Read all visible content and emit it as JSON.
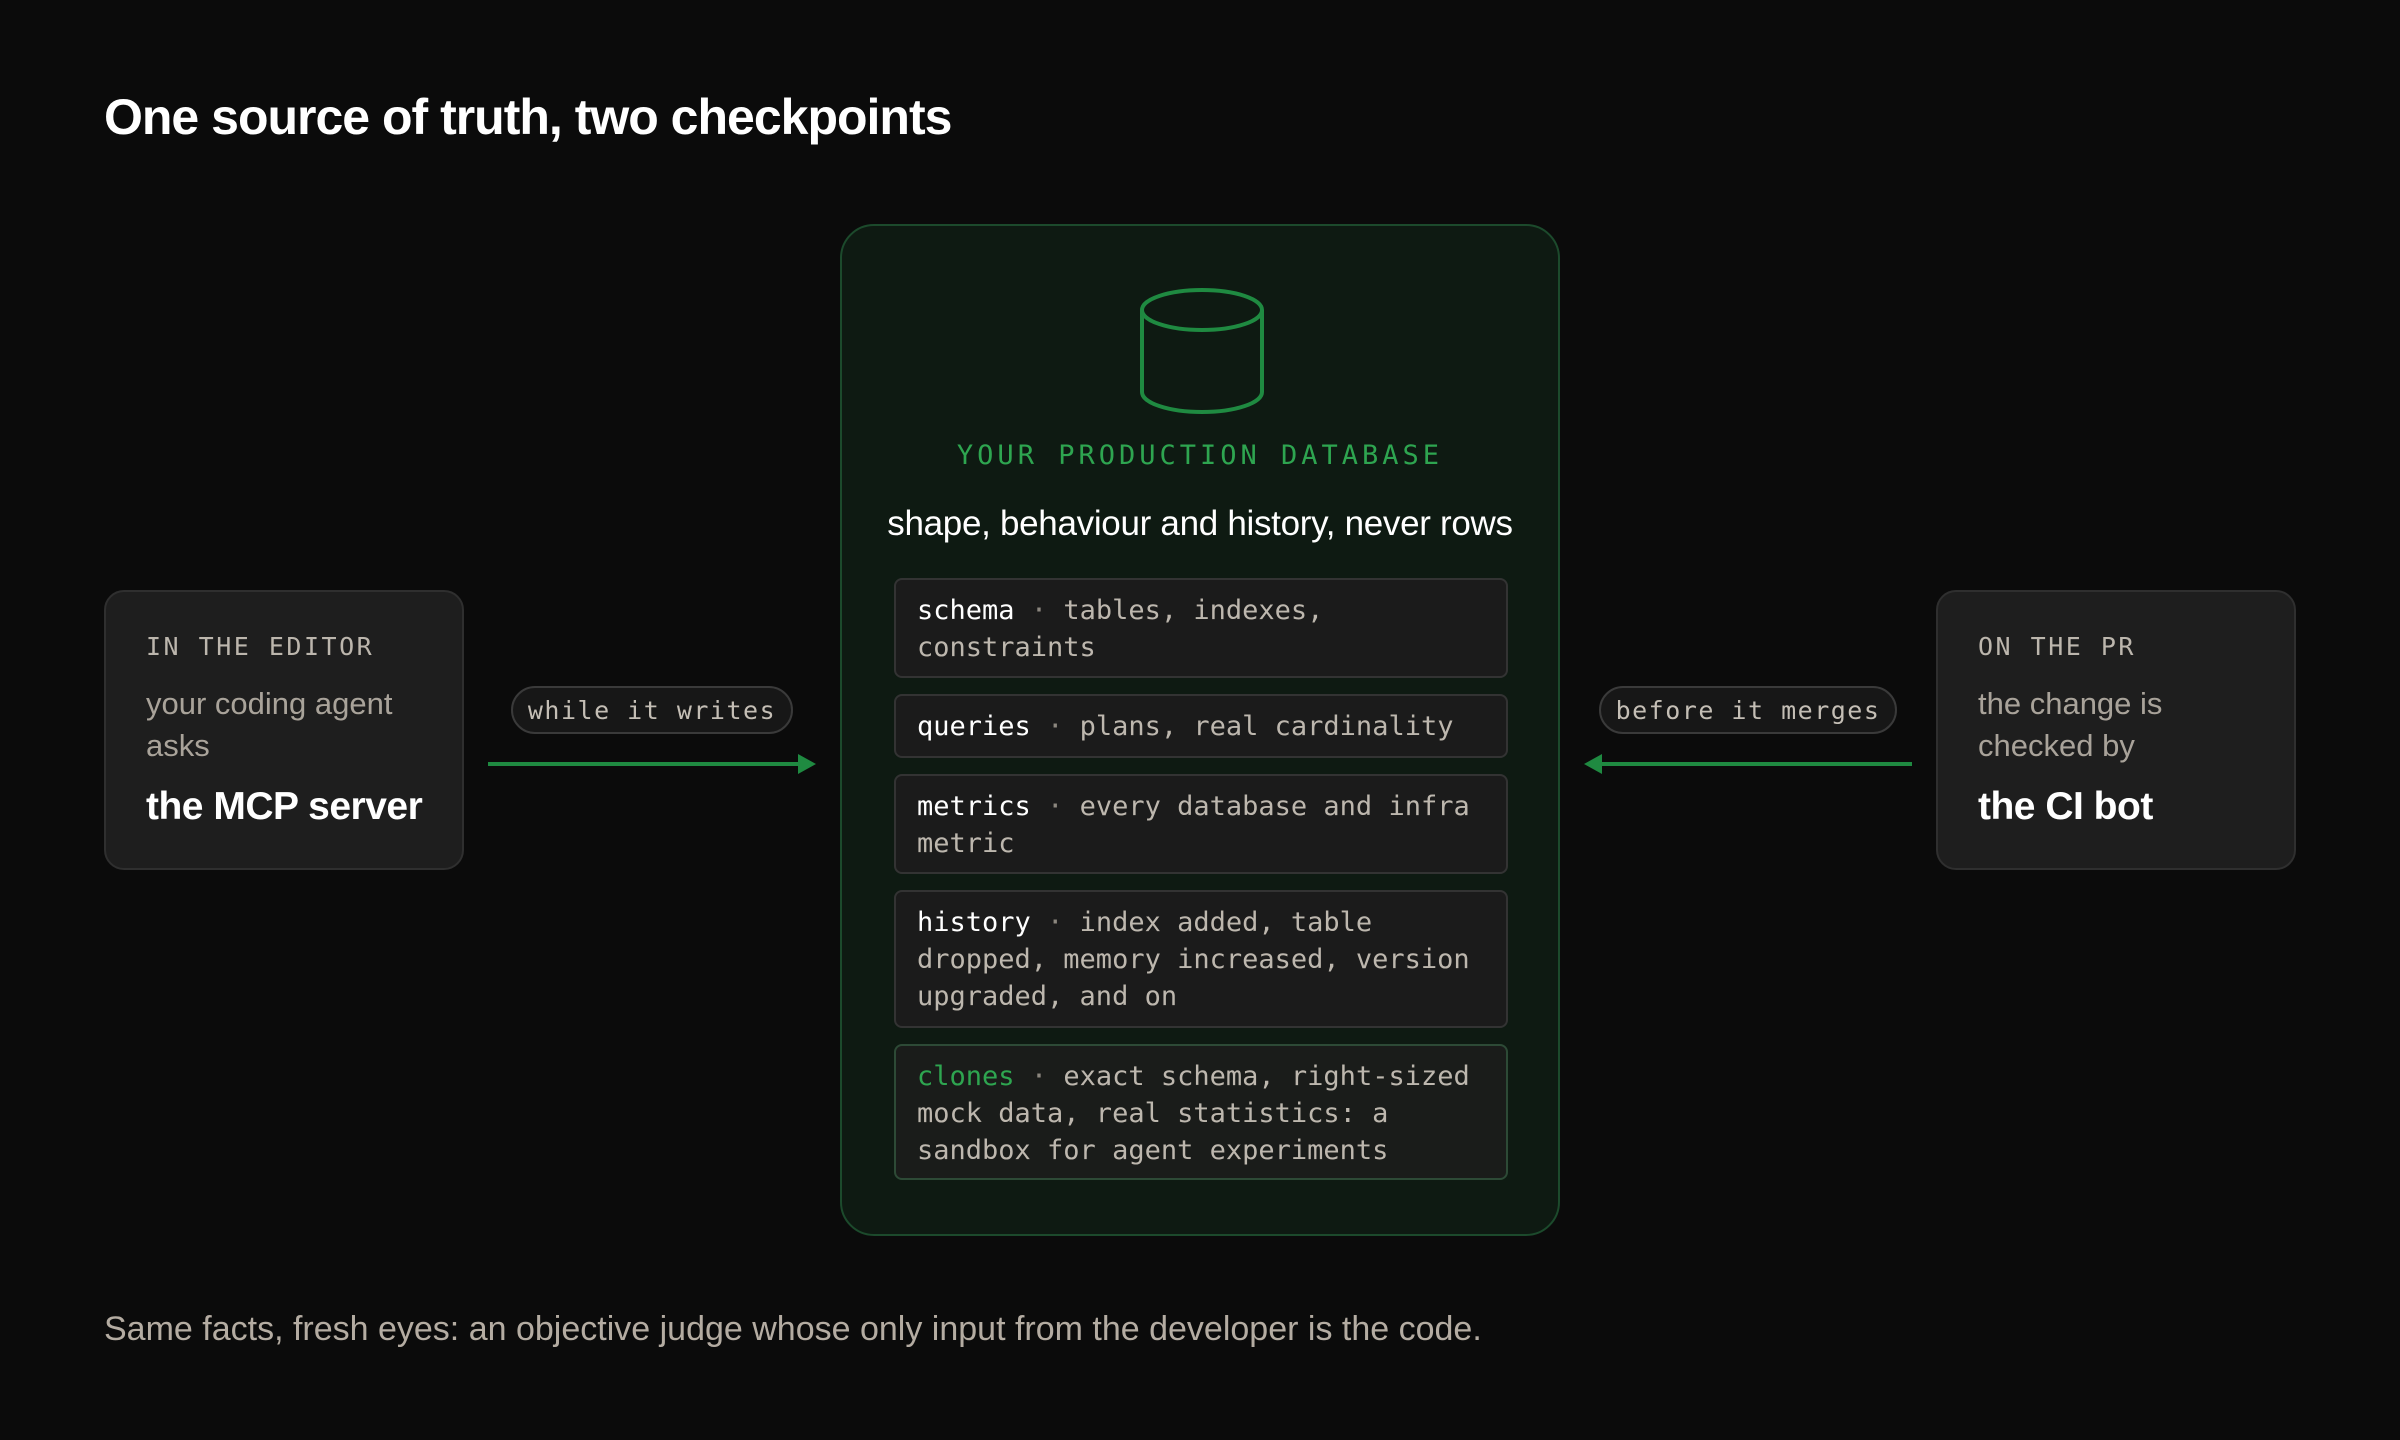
{
  "title": "One source of truth, two checkpoints",
  "left_card": {
    "eyebrow": "IN THE EDITOR",
    "subtitle": "your coding agent asks",
    "main": "the MCP server"
  },
  "left_connector": {
    "label": "while it writes"
  },
  "right_card": {
    "eyebrow": "ON THE PR",
    "subtitle": "the change is checked by",
    "main": "the CI bot"
  },
  "right_connector": {
    "label": "before it merges"
  },
  "database": {
    "icon": "database-cylinder-icon",
    "eyebrow": "YOUR PRODUCTION DATABASE",
    "tagline": "shape, behaviour and history, never rows",
    "features": [
      {
        "name": "schema",
        "separator": "·",
        "desc": "tables, indexes, constraints"
      },
      {
        "name": "queries",
        "separator": "·",
        "desc": "plans, real cardinality"
      },
      {
        "name": "metrics",
        "separator": "·",
        "desc": "every database and infra metric"
      },
      {
        "name": "history",
        "separator": "·",
        "desc": "index added, table dropped, memory increased, version upgraded, and on"
      },
      {
        "name": "clones",
        "separator": "·",
        "desc": "exact schema, right-sized mock data, real statistics: a sandbox for agent experiments"
      }
    ]
  },
  "footnote": "Same facts, fresh eyes: an objective judge whose only input from the developer is the code.",
  "colors": {
    "background": "#0b0b0b",
    "accent_green": "#2ea550",
    "card_border_green": "#1c4a2c",
    "side_card": "#1e1e1e"
  }
}
